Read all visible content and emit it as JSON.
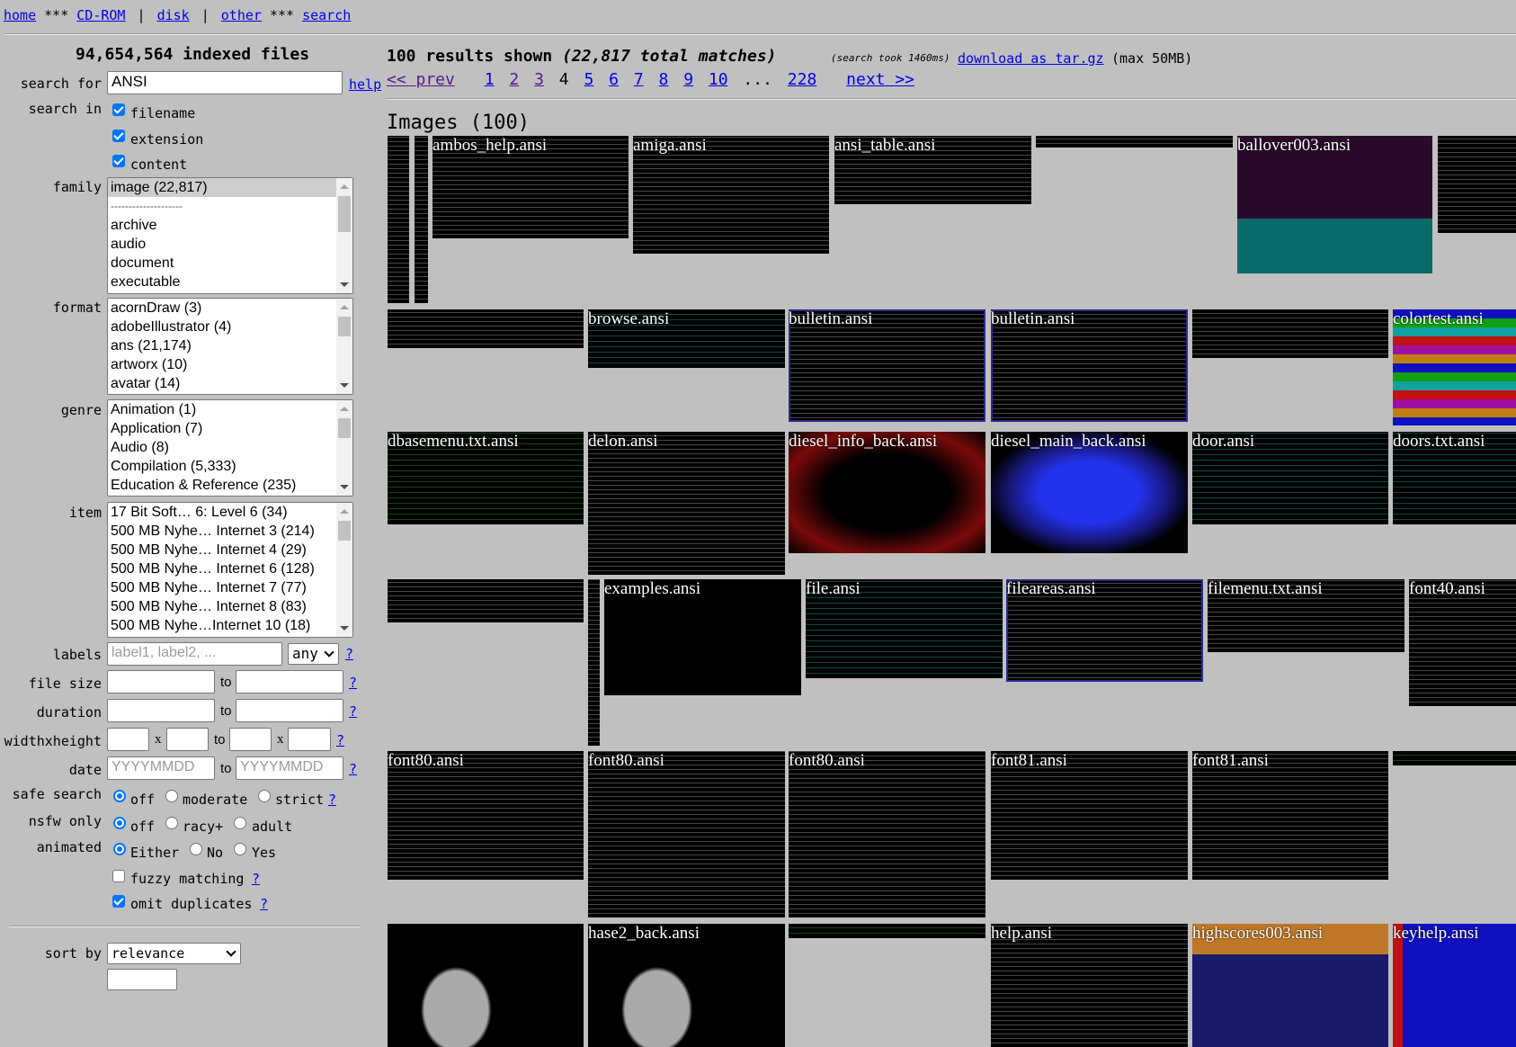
{
  "nav": {
    "links": [
      "home",
      "CD-ROM",
      "disk",
      "other",
      "search"
    ],
    "stars": "***",
    "pipe": "|"
  },
  "sidebar": {
    "indexed": "94,654,564 indexed files",
    "search_for_label": "search for",
    "search_value": "ANSI",
    "help": "help",
    "search_in_label": "search in",
    "search_in": [
      {
        "label": "filename",
        "checked": true
      },
      {
        "label": "extension",
        "checked": true
      },
      {
        "label": "content",
        "checked": true
      }
    ],
    "family_label": "family",
    "family": [
      "image (22,817)",
      "--------------------",
      "archive",
      "audio",
      "document",
      "executable"
    ],
    "format_label": "format",
    "format": [
      "acornDraw (3)",
      "adobeIllustrator (4)",
      "ans (21,174)",
      "artworx (10)",
      "avatar (14)"
    ],
    "genre_label": "genre",
    "genre": [
      "Animation (1)",
      "Application (7)",
      "Audio (8)",
      "Compilation (5,333)",
      "Education & Reference (235)"
    ],
    "item_label": "item",
    "item": [
      "17 Bit Soft… 6: Level 6 (34)",
      "500 MB Nyhe… Internet 3 (214)",
      "500 MB Nyhe… Internet 4 (29)",
      "500 MB Nyhe… Internet 6 (128)",
      "500 MB Nyhe… Internet 7 (77)",
      "500 MB Nyhe… Internet 8 (83)",
      "500 MB Nyhe…Internet 10 (18)"
    ],
    "labels_label": "labels",
    "labels_placeholder": "label1, label2, ...",
    "labels_mode": "any",
    "q": "?",
    "to": "to",
    "x": "x",
    "file_size_label": "file size",
    "duration_label": "duration",
    "wh_label": "widthxheight",
    "date_label": "date",
    "date_placeholder": "YYYYMMDD",
    "safe_label": "safe search",
    "safe": [
      "off",
      "moderate",
      "strict"
    ],
    "nsfw_label": "nsfw only",
    "nsfw": [
      "off",
      "racy+",
      "adult"
    ],
    "animated_label": "animated",
    "animated": [
      "Either",
      "No",
      "Yes"
    ],
    "fuzzy": "fuzzy matching",
    "fuzzy_checked": false,
    "omit": "omit duplicates",
    "omit_checked": true,
    "sort_label": "sort by",
    "sort_value": "relevance"
  },
  "results": {
    "shown": "100 results shown",
    "total": "(22,817 total matches)",
    "took": "(search took 1460ms)",
    "download": "download as tar.gz",
    "max": "(max 50MB)",
    "prev": "<< prev",
    "pages": [
      "1",
      "2",
      "3",
      "4",
      "5",
      "6",
      "7",
      "8",
      "9",
      "10"
    ],
    "current_page": "4",
    "ellipsis": "...",
    "last": "228",
    "next": "next >>",
    "section": "Images (100)",
    "thumbs": [
      "",
      "",
      "ambos_help.ansi",
      "amiga.ansi",
      "ansi_table.ansi",
      "",
      "ballover003.ansi",
      "",
      "",
      "browse.ansi",
      "bulletin.ansi",
      "bulletin.ansi",
      "",
      "colortest.ansi",
      "dbasemenu.txt.ansi",
      "delon.ansi",
      "diesel_info_back.ansi",
      "diesel_main_back.ansi",
      "door.ansi",
      "doors.txt.ansi",
      "",
      "",
      "examples.ansi",
      "file.ansi",
      "fileareas.ansi",
      "filemenu.txt.ansi",
      "font40.ansi",
      "font80.ansi",
      "font80.ansi",
      "font80.ansi",
      "font81.ansi",
      "font81.ansi",
      "",
      "",
      "hase2_back.ansi",
      "",
      "help.ansi",
      "highscores003.ansi",
      "keyhelp.ansi"
    ]
  }
}
